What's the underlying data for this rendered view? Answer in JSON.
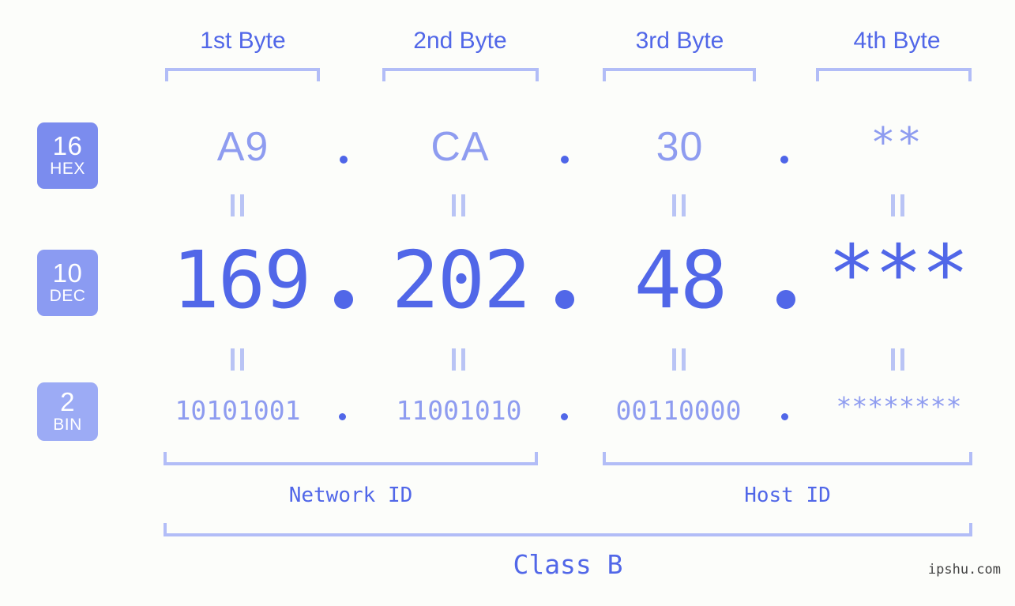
{
  "page": {
    "background_color": "#fcfdfa",
    "accent_strong": "#5167e8",
    "accent_mid": "#8e9cf0",
    "accent_light": "#b2bdf7",
    "watermark": "ipshu.com"
  },
  "byte_headers": [
    {
      "label": "1st Byte"
    },
    {
      "label": "2nd Byte"
    },
    {
      "label": "3rd Byte"
    },
    {
      "label": "4th Byte"
    }
  ],
  "rows": [
    {
      "badge_number": "16",
      "badge_label": "HEX",
      "badge_color": "#7b8cee",
      "values": [
        "A9",
        "CA",
        "30",
        "**"
      ]
    },
    {
      "badge_number": "10",
      "badge_label": "DEC",
      "badge_color": "#8b9bf2",
      "values": [
        "169",
        "202",
        "48",
        "***"
      ]
    },
    {
      "badge_number": "2",
      "badge_label": "BIN",
      "badge_color": "#9cabf5",
      "values": [
        "10101001",
        "11001010",
        "00110000",
        "********"
      ]
    }
  ],
  "separators": {
    "glyph": ".",
    "equality_glyph": "||"
  },
  "sections": [
    {
      "label": "Network ID"
    },
    {
      "label": "Host ID"
    }
  ],
  "class": {
    "label": "Class B"
  }
}
